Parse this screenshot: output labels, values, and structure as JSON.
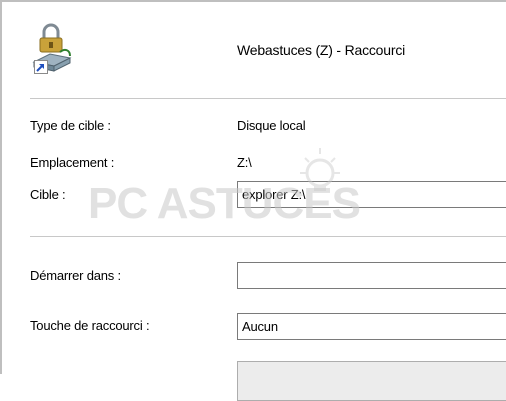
{
  "window": {
    "title": "Webastuces (Z) - Raccourci"
  },
  "icon": {
    "name": "network-drive-lock-shortcut-icon",
    "overlay": "shortcut-arrow-icon"
  },
  "properties": {
    "type_label": "Type de cible :",
    "type_value": "Disque local",
    "location_label": "Emplacement :",
    "location_value": "Z:\\",
    "target_label": "Cible :",
    "target_value": "explorer Z:\\"
  },
  "options": {
    "start_in_label": "Démarrer dans :",
    "start_in_value": "",
    "hotkey_label": "Touche de raccourci :",
    "hotkey_value": "Aucun"
  },
  "watermark": {
    "text": "PC ASTUCES"
  },
  "colors": {
    "border": "#7a7a7a",
    "separator": "#c8c8c8",
    "watermark": "#c9c9c9"
  }
}
